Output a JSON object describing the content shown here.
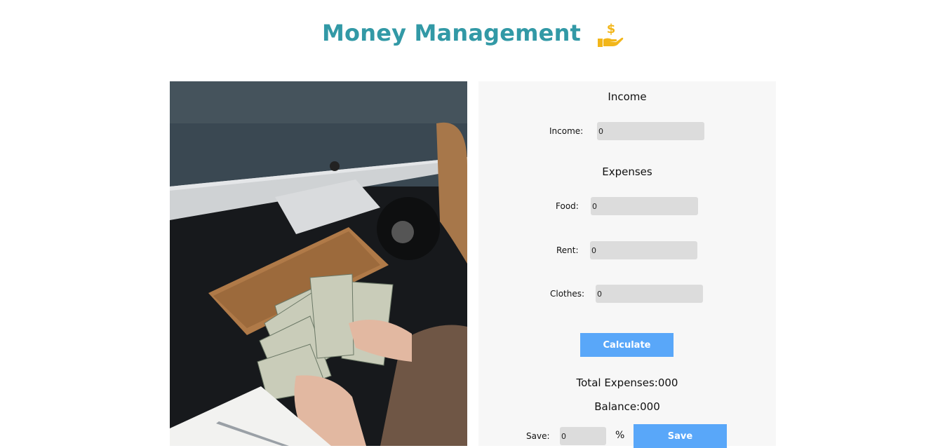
{
  "header": {
    "title": "Money Management",
    "icon": "hand-holding-dollar-icon",
    "icon_color": "#f2b61a",
    "title_color": "#3299a6"
  },
  "income": {
    "heading": "Income",
    "label": "Income:",
    "value": "0"
  },
  "expenses": {
    "heading": "Expenses",
    "food_label": "Food:",
    "food_value": "0",
    "rent_label": "Rent:",
    "rent_value": "0",
    "clothes_label": "Clothes:",
    "clothes_value": "0"
  },
  "calculate_label": "Calculate",
  "results": {
    "total_expenses": "Total Expenses:000",
    "balance": "Balance:000"
  },
  "save": {
    "label": "Save:",
    "value": "0",
    "percent_symbol": "%",
    "button_label": "Save"
  },
  "accent_color": "#59a7f9"
}
